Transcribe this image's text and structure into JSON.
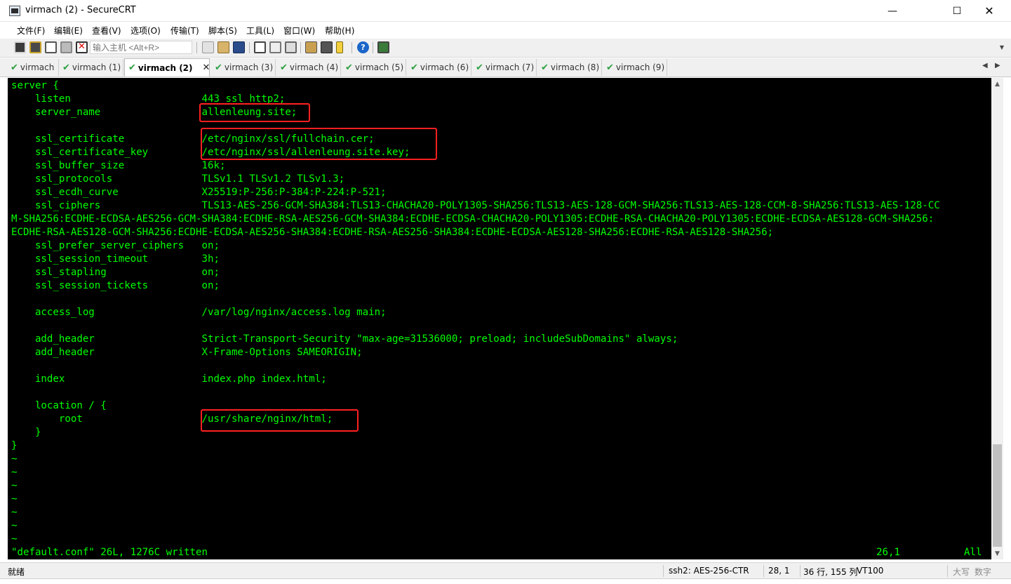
{
  "window": {
    "title": "virmach (2) - SecureCRT",
    "minimize": "—",
    "maximize": "☐",
    "close": "✕"
  },
  "menu": [
    "文件(F)",
    "编辑(E)",
    "查看(V)",
    "选项(O)",
    "传输(T)",
    "脚本(S)",
    "工具(L)",
    "窗口(W)",
    "帮助(H)"
  ],
  "toolbar": {
    "host_input_placeholder": "输入主机 <Alt+R>",
    "icons": [
      "connect-icon",
      "quick-connect-icon",
      "connect-in-tab-icon",
      "reconnect-icon",
      "disconnect-icon",
      "copy-icon",
      "paste-icon",
      "find-icon",
      "print-icon",
      "print-setup-icon",
      "print-selection-icon",
      "session-options-icon",
      "global-options-icon",
      "keymap-icon",
      "help-icon",
      "screenshot-icon"
    ]
  },
  "tabs": [
    {
      "label": "virmach",
      "active": false
    },
    {
      "label": "virmach (1)",
      "active": false
    },
    {
      "label": "virmach (2)",
      "active": true
    },
    {
      "label": "virmach (3)",
      "active": false
    },
    {
      "label": "virmach (4)",
      "active": false
    },
    {
      "label": "virmach (5)",
      "active": false
    },
    {
      "label": "virmach (6)",
      "active": false
    },
    {
      "label": "virmach (7)",
      "active": false
    },
    {
      "label": "virmach (8)",
      "active": false
    },
    {
      "label": "virmach (9)",
      "active": false
    }
  ],
  "terminal": {
    "colors": {
      "background": "#000000",
      "text": "#00ff00",
      "highlight": "#ff2020"
    },
    "lines": [
      "server {",
      "    listen                      443 ssl http2;",
      "    server_name                 allenleung.site;",
      "",
      "    ssl_certificate             /etc/nginx/ssl/fullchain.cer;",
      "    ssl_certificate_key         /etc/nginx/ssl/allenleung.site.key;",
      "    ssl_buffer_size             16k;",
      "    ssl_protocols               TLSv1.1 TLSv1.2 TLSv1.3;",
      "    ssl_ecdh_curve              X25519:P-256:P-384:P-224:P-521;",
      "    ssl_ciphers                 TLS13-AES-256-GCM-SHA384:TLS13-CHACHA20-POLY1305-SHA256:TLS13-AES-128-GCM-SHA256:TLS13-AES-128-CCM-8-SHA256:TLS13-AES-128-CC",
      "M-SHA256:ECDHE-ECDSA-AES256-GCM-SHA384:ECDHE-RSA-AES256-GCM-SHA384:ECDHE-ECDSA-CHACHA20-POLY1305:ECDHE-RSA-CHACHA20-POLY1305:ECDHE-ECDSA-AES128-GCM-SHA256:",
      "ECDHE-RSA-AES128-GCM-SHA256:ECDHE-ECDSA-AES256-SHA384:ECDHE-RSA-AES256-SHA384:ECDHE-ECDSA-AES128-SHA256:ECDHE-RSA-AES128-SHA256;",
      "    ssl_prefer_server_ciphers   on;",
      "    ssl_session_timeout         3h;",
      "    ssl_stapling                on;",
      "    ssl_session_tickets         on;",
      "",
      "    access_log                  /var/log/nginx/access.log main;",
      "",
      "    add_header                  Strict-Transport-Security \"max-age=31536000; preload; includeSubDomains\" always;",
      "    add_header                  X-Frame-Options SAMEORIGIN;",
      "",
      "    index                       index.php index.html;",
      "",
      "    location / {",
      "        root                    /usr/share/nginx/html;",
      "    }",
      "}",
      "~",
      "~",
      "~",
      "~",
      "~",
      "~",
      "~",
      "\"default.conf\" 26L, 1276C written"
    ],
    "cursor_position": "26,1",
    "scroll_position": "All"
  },
  "statusbar": {
    "ready": "就绪",
    "cipher": "ssh2: AES-256-CTR",
    "cursor": "28,   1",
    "size": "36 行, 155 列",
    "terminal_type": "VT100",
    "caps": "大写",
    "num": "数字"
  }
}
